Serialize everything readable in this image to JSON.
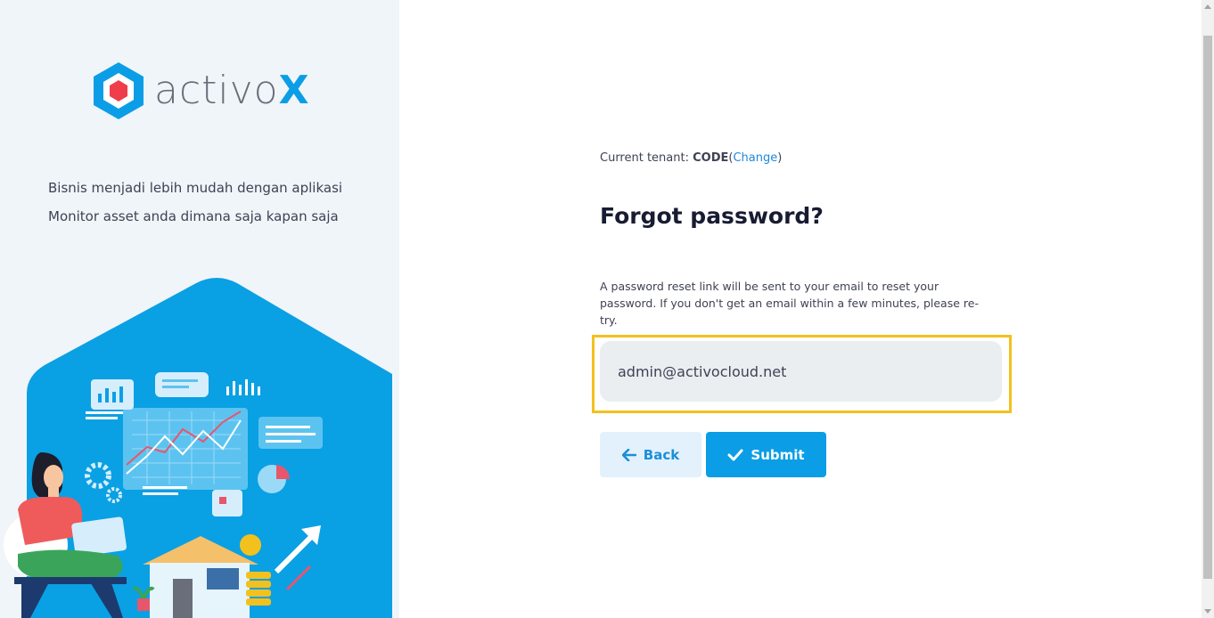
{
  "brand": {
    "name_prefix": "activo",
    "name_suffix": "X",
    "accent_color": "#0b9ee6",
    "logo_icon": "hexagon-logo-icon"
  },
  "aside": {
    "tagline_1": "Bisnis menjadi lebih mudah dengan aplikasi",
    "tagline_2": "Monitor asset anda dimana saja kapan saja",
    "illustration": "business-analytics-illustration"
  },
  "tenant": {
    "label": "Current tenant:",
    "name": "CODE",
    "open_paren": "(",
    "change_link": "Change",
    "close_paren": ")"
  },
  "form": {
    "title": "Forgot password?",
    "description": "A password reset link will be sent to your email to reset your password. If you don't get an email within a few minutes, please re-try.",
    "email_value": "admin@activocloud.net",
    "back_label": "Back",
    "back_icon": "arrow-left-icon",
    "submit_label": "Submit",
    "submit_icon": "check-icon"
  }
}
